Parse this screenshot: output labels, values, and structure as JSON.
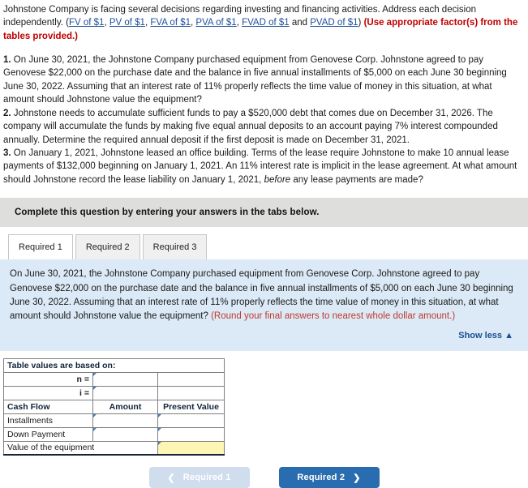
{
  "intro": {
    "lead": "Johnstone Company is facing several decisions regarding investing and financing activities. Address each decision independently. (",
    "links": [
      {
        "label": "FV of $1",
        "sep": ", "
      },
      {
        "label": "PV of $1",
        "sep": ", "
      },
      {
        "label": "FVA of $1",
        "sep": ", "
      },
      {
        "label": "PVA of $1",
        "sep": ", "
      },
      {
        "label": "FVAD of $1",
        "sep": " and "
      },
      {
        "label": "PVAD of $1",
        "sep": ")"
      }
    ],
    "note": "(Use appropriate factor(s) from the tables provided.)"
  },
  "problems": [
    {
      "number": "1.",
      "text": " On June 30, 2021, the Johnstone Company purchased equipment from Genovese Corp. Johnstone agreed to pay Genovese $22,000 on the purchase date and the balance in five annual installments of $5,000 on each June 30 beginning June 30, 2022. Assuming that an interest rate of 11% properly reflects the time value of money in this situation, at what amount should Johnstone value the equipment?"
    },
    {
      "number": "2.",
      "text": " Johnstone needs to accumulate sufficient funds to pay a $520,000 debt that comes due on December 31, 2026. The company will accumulate the funds by making five equal annual deposits to an account paying 7% interest compounded annually. Determine the required annual deposit if the first deposit is made on December 31, 2021."
    },
    {
      "number": "3.",
      "text_before_italic": " On January 1, 2021, Johnstone leased an office building. Terms of the lease require Johnstone to make 10 annual lease payments of $132,000 beginning on January 1, 2021. An 11% interest rate is implicit in the lease agreement. At what amount should Johnstone record the lease liability on January 1, 2021, ",
      "italic": "before",
      "text_after_italic": " any lease payments are made?"
    }
  ],
  "instruction_bar": {
    "text": "Complete this question by entering your answers in the tabs below."
  },
  "tabs": [
    {
      "label": "Required 1",
      "active": true
    },
    {
      "label": "Required 2",
      "active": false
    },
    {
      "label": "Required 3",
      "active": false
    }
  ],
  "panel": {
    "body": "On June 30, 2021, the Johnstone Company purchased equipment from Genovese Corp. Johnstone agreed to pay Genovese $22,000 on the purchase date and the balance in five annual installments of $5,000 on each June 30 beginning June 30, 2022. Assuming that an interest rate of 11% properly reflects the time value of money in this situation, at what amount should Johnstone value the equipment? ",
    "rounding_note": "(Round your final answers to nearest whole dollar amount.)",
    "show_less": "Show less ▲"
  },
  "answer_table": {
    "caption": "Table values are based on:",
    "n_label": "n =",
    "n_value": "",
    "i_label": "i =",
    "i_value": "",
    "headers": [
      "Cash Flow",
      "Amount",
      "Present Value"
    ],
    "rows": [
      {
        "label": "Installments",
        "amount": "",
        "present_value": ""
      },
      {
        "label": "Down Payment",
        "amount": "",
        "present_value": ""
      }
    ],
    "total_label": "Value of the equipment",
    "total_value": ""
  },
  "nav": {
    "prev_label": "Required 1",
    "prev_chevron": "❮",
    "next_label": "Required 2",
    "next_chevron": "❯"
  },
  "colors": {
    "panel_bg": "#dbeaf6",
    "table_header_blue": "#7aaddc",
    "answer_yellow": "#fdf5b4",
    "next_button_blue": "#2a6cb0",
    "prev_button_blue": "#cfdded",
    "link_blue": "#1d4e9c",
    "red_note": "#c00000",
    "instruction_gray": "#dededd"
  }
}
